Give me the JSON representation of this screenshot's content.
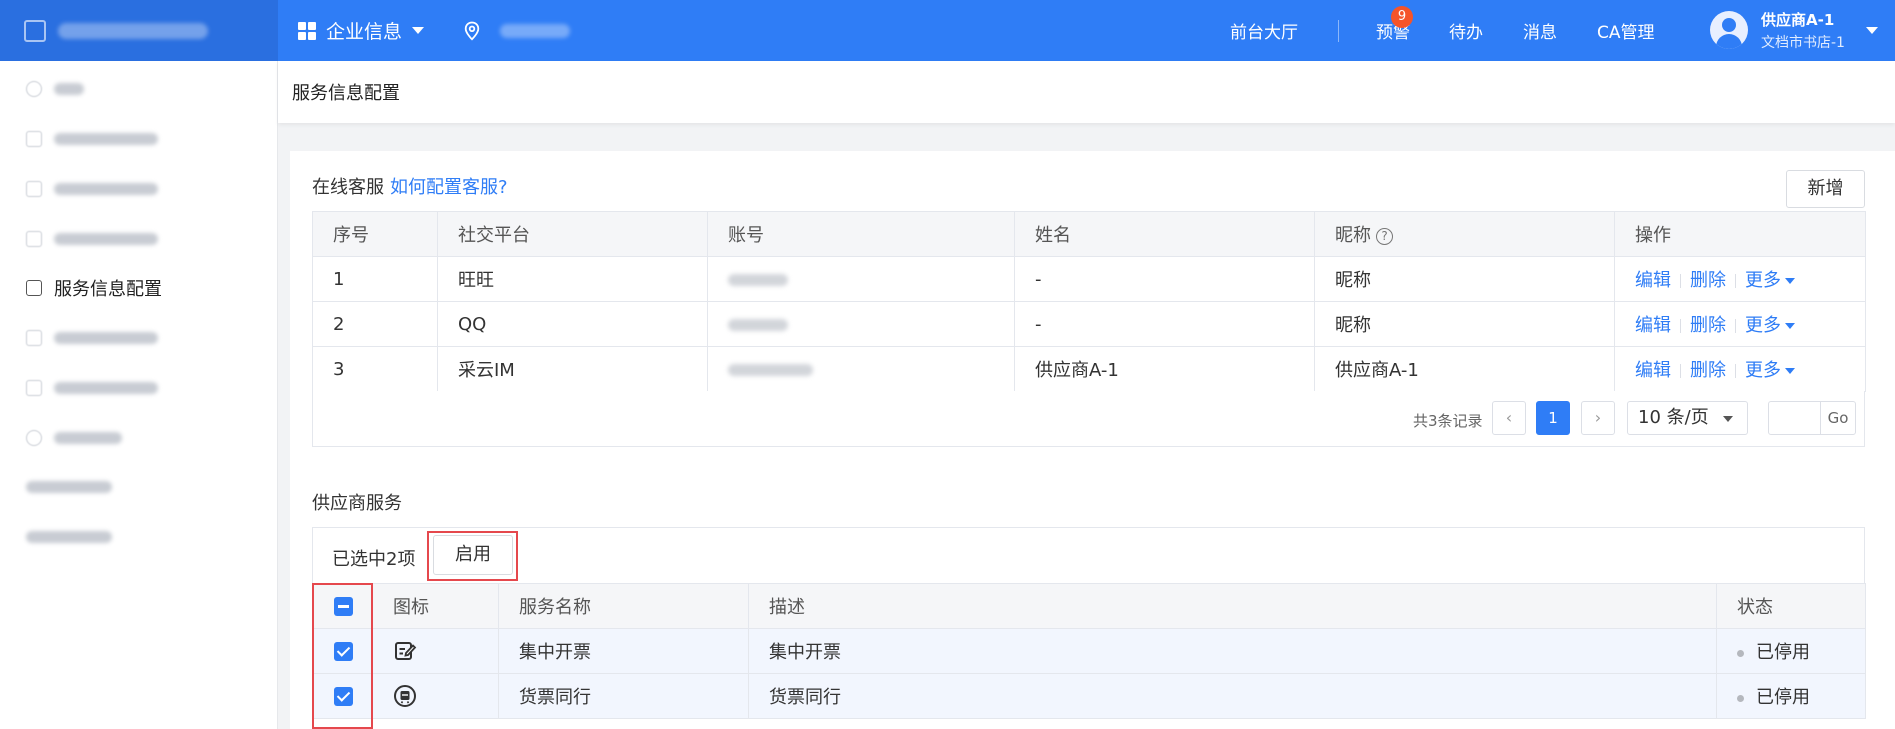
{
  "topbar": {
    "nav_menu_label": "企业信息",
    "links": [
      "前台大厅",
      "预警",
      "待办",
      "消息",
      "CA管理"
    ],
    "alert_badge": "9",
    "user": {
      "name": "供应商A-1",
      "org": "文档市书店-1"
    }
  },
  "sidebar": {
    "active_label": "服务信息配置"
  },
  "page": {
    "title": "服务信息配置"
  },
  "online_service": {
    "title": "在线客服",
    "help_link": "如何配置客服?",
    "add_button": "新增",
    "columns": [
      "序号",
      "社交平台",
      "账号",
      "姓名",
      "昵称",
      "操作"
    ],
    "rows": [
      {
        "no": "1",
        "platform": "旺旺",
        "name": "-",
        "nickname": "昵称"
      },
      {
        "no": "2",
        "platform": "QQ",
        "name": "-",
        "nickname": "昵称"
      },
      {
        "no": "3",
        "platform": "采云IM",
        "name": "供应商A-1",
        "nickname": "供应商A-1"
      }
    ],
    "actions": {
      "edit": "编辑",
      "delete": "删除",
      "more": "更多"
    },
    "pagination": {
      "total": "共3条记录",
      "current_page": "1",
      "page_size": "10 条/页",
      "go": "Go",
      "prev": "‹",
      "next": "›"
    }
  },
  "supplier_service": {
    "title": "供应商服务",
    "selected_text": "已选中2项",
    "enable_button": "启用",
    "columns": [
      "图标",
      "服务名称",
      "描述",
      "状态"
    ],
    "rows": [
      {
        "name": "集中开票",
        "desc": "集中开票",
        "status": "已停用",
        "icon": "invoice-edit-icon"
      },
      {
        "name": "货票同行",
        "desc": "货票同行",
        "status": "已停用",
        "icon": "goods-ticket-icon"
      }
    ]
  },
  "colors": {
    "primary": "#2f7df6",
    "highlight_border": "#e5484d",
    "badge": "#f5542a"
  }
}
